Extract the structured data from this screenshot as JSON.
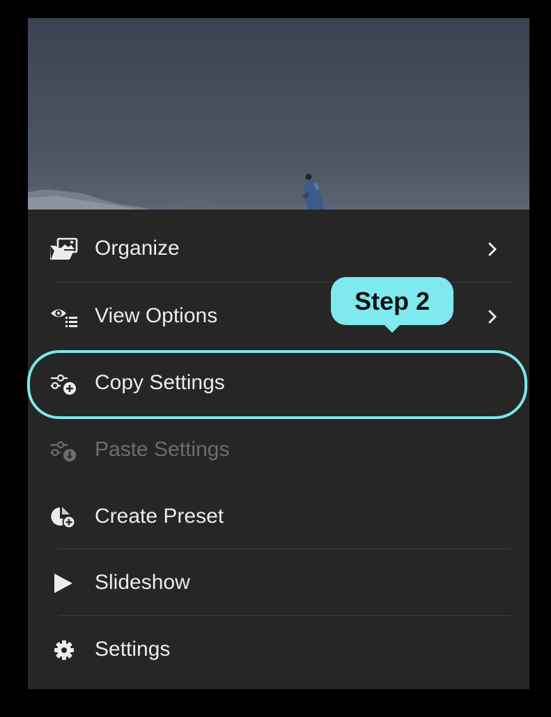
{
  "menu": {
    "items": [
      {
        "label": "Organize",
        "icon": "folder-images-icon",
        "has_submenu": true,
        "enabled": true
      },
      {
        "label": "View Options",
        "icon": "eye-list-icon",
        "has_submenu": true,
        "enabled": true
      },
      {
        "label": "Copy Settings",
        "icon": "sliders-plus-icon",
        "has_submenu": false,
        "enabled": true
      },
      {
        "label": "Paste Settings",
        "icon": "sliders-download-icon",
        "has_submenu": false,
        "enabled": false
      },
      {
        "label": "Create Preset",
        "icon": "preset-plus-icon",
        "has_submenu": false,
        "enabled": true
      },
      {
        "label": "Slideshow",
        "icon": "play-icon",
        "has_submenu": false,
        "enabled": true
      },
      {
        "label": "Settings",
        "icon": "gear-icon",
        "has_submenu": false,
        "enabled": true
      }
    ]
  },
  "annotation": {
    "callout_text": "Step 2",
    "highlighted_item": "Copy Settings"
  },
  "colors": {
    "panel_background": "#262626",
    "highlight": "#7ee8ec",
    "text": "#ececec",
    "disabled_text": "#6d6d6d"
  }
}
